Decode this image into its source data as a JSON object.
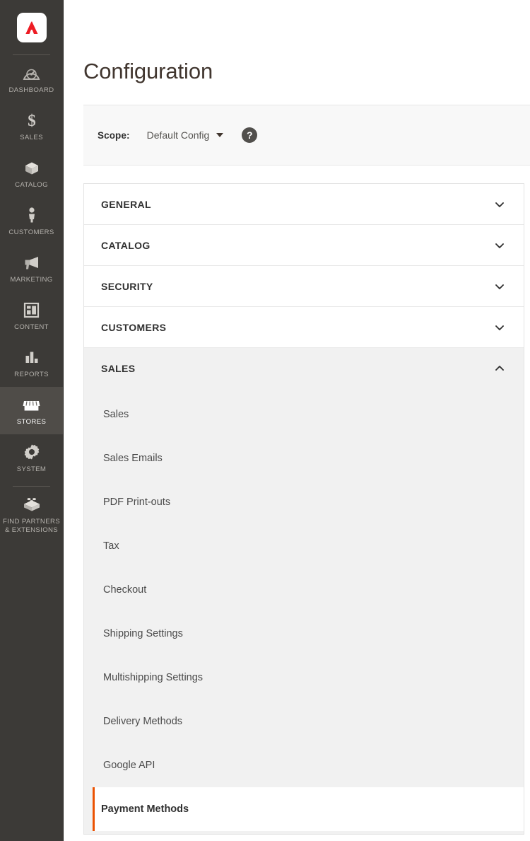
{
  "sidebar": {
    "logo": {
      "icon": "adobe-logo-icon",
      "color": "#ed1c24"
    },
    "items": [
      {
        "label": "Dashboard",
        "icon": "dashboard-gauge-icon",
        "active": false
      },
      {
        "label": "Sales",
        "icon": "dollar-sign-icon",
        "active": false
      },
      {
        "label": "Catalog",
        "icon": "box-icon",
        "active": false
      },
      {
        "label": "Customers",
        "icon": "person-icon",
        "active": false
      },
      {
        "label": "Marketing",
        "icon": "megaphone-icon",
        "active": false
      },
      {
        "label": "Content",
        "icon": "layout-page-icon",
        "active": false
      },
      {
        "label": "Reports",
        "icon": "bar-chart-icon",
        "active": false
      },
      {
        "label": "Stores",
        "icon": "storefront-icon",
        "active": true
      },
      {
        "label": "System",
        "icon": "gear-icon",
        "active": false
      },
      {
        "label": "Find Partners & Extensions",
        "icon": "lego-brick-icon",
        "active": false
      }
    ]
  },
  "header": {
    "title": "Configuration"
  },
  "scope": {
    "label": "Scope:",
    "value": "Default Config",
    "help_glyph": "?",
    "caret_icon": "chevron-down-icon"
  },
  "accordion": {
    "sections": [
      {
        "title": "General",
        "open": false,
        "chevron": "chevron-down-icon"
      },
      {
        "title": "Catalog",
        "open": false,
        "chevron": "chevron-down-icon"
      },
      {
        "title": "Security",
        "open": false,
        "chevron": "chevron-down-icon"
      },
      {
        "title": "Customers",
        "open": false,
        "chevron": "chevron-down-icon"
      },
      {
        "title": "Sales",
        "open": true,
        "chevron": "chevron-up-icon"
      }
    ],
    "sales_items": [
      {
        "label": "Sales",
        "active": false
      },
      {
        "label": "Sales Emails",
        "active": false
      },
      {
        "label": "PDF Print-outs",
        "active": false
      },
      {
        "label": "Tax",
        "active": false
      },
      {
        "label": "Checkout",
        "active": false
      },
      {
        "label": "Shipping Settings",
        "active": false
      },
      {
        "label": "Multishipping Settings",
        "active": false
      },
      {
        "label": "Delivery Methods",
        "active": false
      },
      {
        "label": "Google API",
        "active": false
      },
      {
        "label": "Payment Methods",
        "active": true
      }
    ]
  },
  "colors": {
    "sidebar_bg": "#3c3a37",
    "sidebar_active_bg": "#4f4c48",
    "accent_orange": "#eb5202",
    "panel_gray": "#f1f1f1",
    "scope_bar_bg": "#f8f8f8",
    "title_text": "#41362f"
  }
}
